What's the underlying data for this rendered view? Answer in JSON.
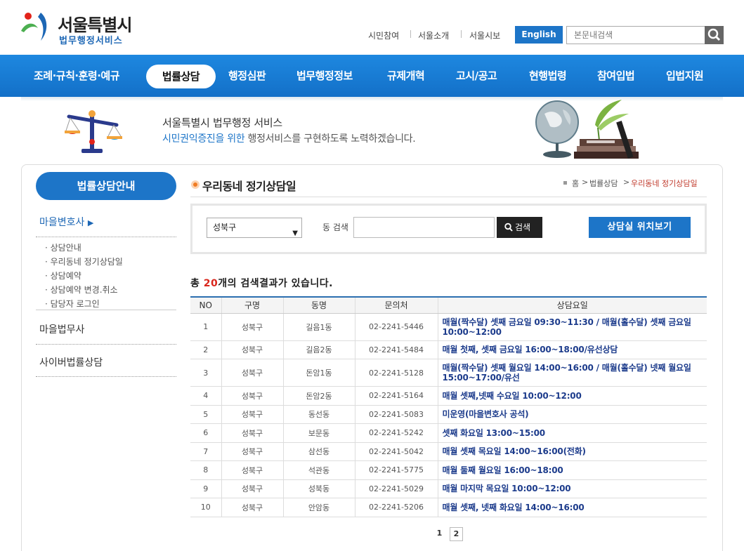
{
  "header": {
    "logo_title": "서울특별시",
    "logo_sub": "법무행정서비스",
    "util_links": [
      "시민참여",
      "서울소개",
      "서울시보"
    ],
    "english_label": "English",
    "search_placeholder": "본문내검색"
  },
  "nav": {
    "items": [
      "조례·규칙·훈령·예규",
      "법률상담",
      "행정심판",
      "법무행정정보",
      "규제개혁",
      "고시/공고",
      "현행법령",
      "참여입법",
      "입법지원"
    ],
    "active_index": 1
  },
  "banner": {
    "line1": "서울특별시 법무행정 서비스",
    "line2_highlight": "시민권익증진을 위한",
    "line2_rest": " 행정서비스를 구현하도록 노력하겠습니다."
  },
  "sidebar": {
    "title": "법률상담안내",
    "active_category": "마을변호사",
    "sub_items": [
      "상담안내",
      "우리동네 정기상담일",
      "상담예약",
      "상담예약 변경.취소",
      "담당자 로그인"
    ],
    "other_categories": [
      "마을법무사",
      "사이버법률상담"
    ]
  },
  "main": {
    "page_title": "우리동네 정기상담일",
    "breadcrumb": [
      "홈",
      "법률상담",
      "우리동네 정기상담일"
    ],
    "search": {
      "district_value": "성북구",
      "dong_label": "동 검색",
      "search_button": "검색",
      "location_button": "상담실 위치보기"
    },
    "result_prefix": "총 ",
    "result_count": "20",
    "result_suffix": "개의 검색결과가 있습니다."
  },
  "table": {
    "headers": [
      "NO",
      "구명",
      "동명",
      "문의처",
      "상담요일"
    ],
    "rows": [
      {
        "no": "1",
        "gu": "성북구",
        "dong": "길음1동",
        "phone": "02-2241-5446",
        "schedule": "매월(짝수달) 셋째 금요일 09:30~11:30 / 매월(홀수달) 셋째 금요일 10:00~12:00"
      },
      {
        "no": "2",
        "gu": "성북구",
        "dong": "길음2동",
        "phone": "02-2241-5484",
        "schedule": "매월 첫째, 셋째 금요일 16:00~18:00/유선상담"
      },
      {
        "no": "3",
        "gu": "성북구",
        "dong": "돈암1동",
        "phone": "02-2241-5128",
        "schedule": "매월(짝수달) 셋째 월요일 14:00~16:00 / 매월(홀수달) 넷째 월요일 15:00~17:00/유선"
      },
      {
        "no": "4",
        "gu": "성북구",
        "dong": "돈암2동",
        "phone": "02-2241-5164",
        "schedule": "매월 셋째,넷째 수요일 10:00~12:00"
      },
      {
        "no": "5",
        "gu": "성북구",
        "dong": "동선동",
        "phone": "02-2241-5083",
        "schedule": "미운영(마을변호사 공석)"
      },
      {
        "no": "6",
        "gu": "성북구",
        "dong": "보문동",
        "phone": "02-2241-5242",
        "schedule": "셋째 화요일 13:00~15:00"
      },
      {
        "no": "7",
        "gu": "성북구",
        "dong": "삼선동",
        "phone": "02-2241-5042",
        "schedule": "매월 셋째 목요일 14:00~16:00(전화)"
      },
      {
        "no": "8",
        "gu": "성북구",
        "dong": "석관동",
        "phone": "02-2241-5775",
        "schedule": "매월 둘째 월요일 16:00~18:00"
      },
      {
        "no": "9",
        "gu": "성북구",
        "dong": "성북동",
        "phone": "02-2241-5029",
        "schedule": "매월 마지막 목요일 10:00~12:00"
      },
      {
        "no": "10",
        "gu": "성북구",
        "dong": "안암동",
        "phone": "02-2241-5206",
        "schedule": "매월 셋째, 넷째 화요일 14:00~16:00"
      }
    ]
  },
  "pagination": {
    "pages": [
      "1",
      "2"
    ],
    "current": "1"
  }
}
